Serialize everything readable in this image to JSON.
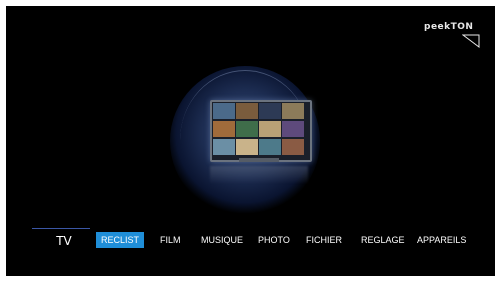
{
  "brand": {
    "logo_text": "peekTON"
  },
  "header": {
    "section_label": "TV"
  },
  "menu": {
    "items": [
      {
        "label": "RECLIST",
        "active": true
      },
      {
        "label": "FILM",
        "active": false
      },
      {
        "label": "MUSIQUE",
        "active": false
      },
      {
        "label": "PHOTO",
        "active": false
      },
      {
        "label": "FICHIER",
        "active": false
      },
      {
        "label": "REGLAGE",
        "active": false
      },
      {
        "label": "APPAREILS",
        "active": false
      }
    ]
  },
  "colors": {
    "background": "#000000",
    "active_highlight": "#1f8ed8",
    "text": "#ffffff"
  },
  "icons": {
    "center": "tv-icon",
    "logo_mark": "flag-icon"
  }
}
